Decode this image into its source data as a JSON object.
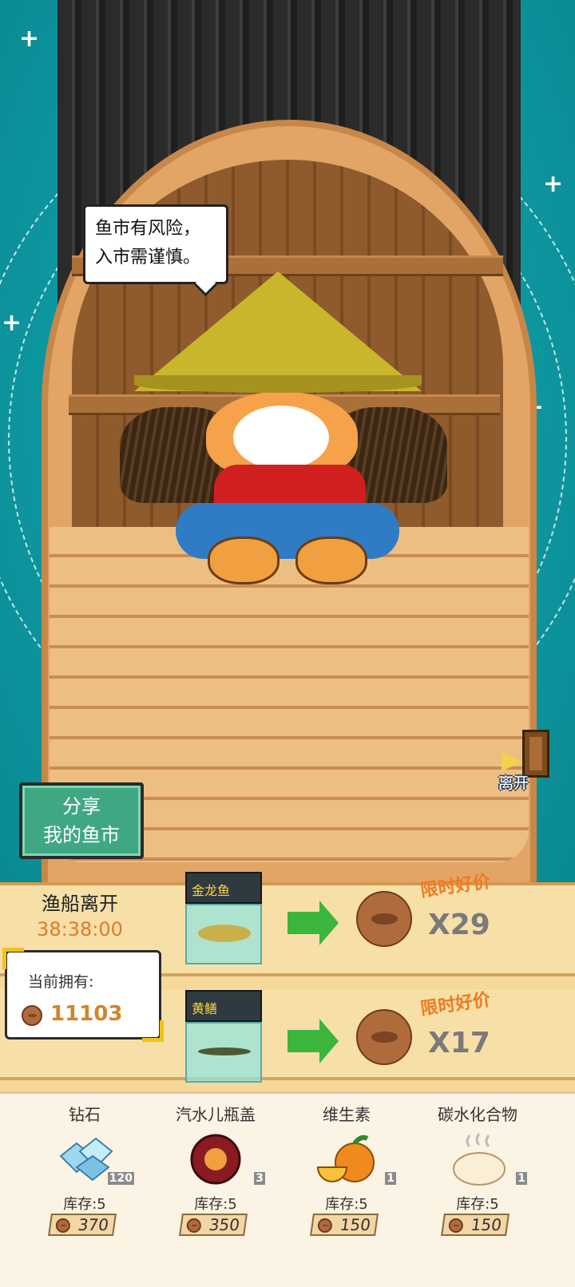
{
  "speech_bubble": {
    "line1": "鱼市有风险，",
    "line2": "入市需谨慎。"
  },
  "share_button": {
    "line1": "分享",
    "line2": "我的鱼市"
  },
  "leave_button": {
    "label": "离开"
  },
  "boat_departure": {
    "title": "渔船离开",
    "timer": "38:38:00"
  },
  "owned": {
    "label": "当前拥有:",
    "value": "11103"
  },
  "offers": [
    {
      "fish_name": "金龙鱼",
      "deal_label": "限时好价",
      "price": "X29"
    },
    {
      "fish_name": "黄鳝",
      "deal_label": "限时好价",
      "price": "X17"
    }
  ],
  "shop": [
    {
      "name": "钻石",
      "count": "120",
      "stock": "库存:5",
      "price": "370",
      "icon": "diamond-icon"
    },
    {
      "name": "汽水儿瓶盖",
      "count": "3",
      "stock": "库存:5",
      "price": "350",
      "icon": "bottle-cap-icon"
    },
    {
      "name": "维生素",
      "count": "1",
      "stock": "库存:5",
      "price": "150",
      "icon": "orange-icon"
    },
    {
      "name": "碳水化合物",
      "count": "1",
      "stock": "库存:5",
      "price": "150",
      "icon": "bun-icon"
    }
  ],
  "colors": {
    "sea": "#0f9aa3",
    "timer": "#e07a2a",
    "deal": "#f07a22",
    "share_button": "#3fa882"
  }
}
